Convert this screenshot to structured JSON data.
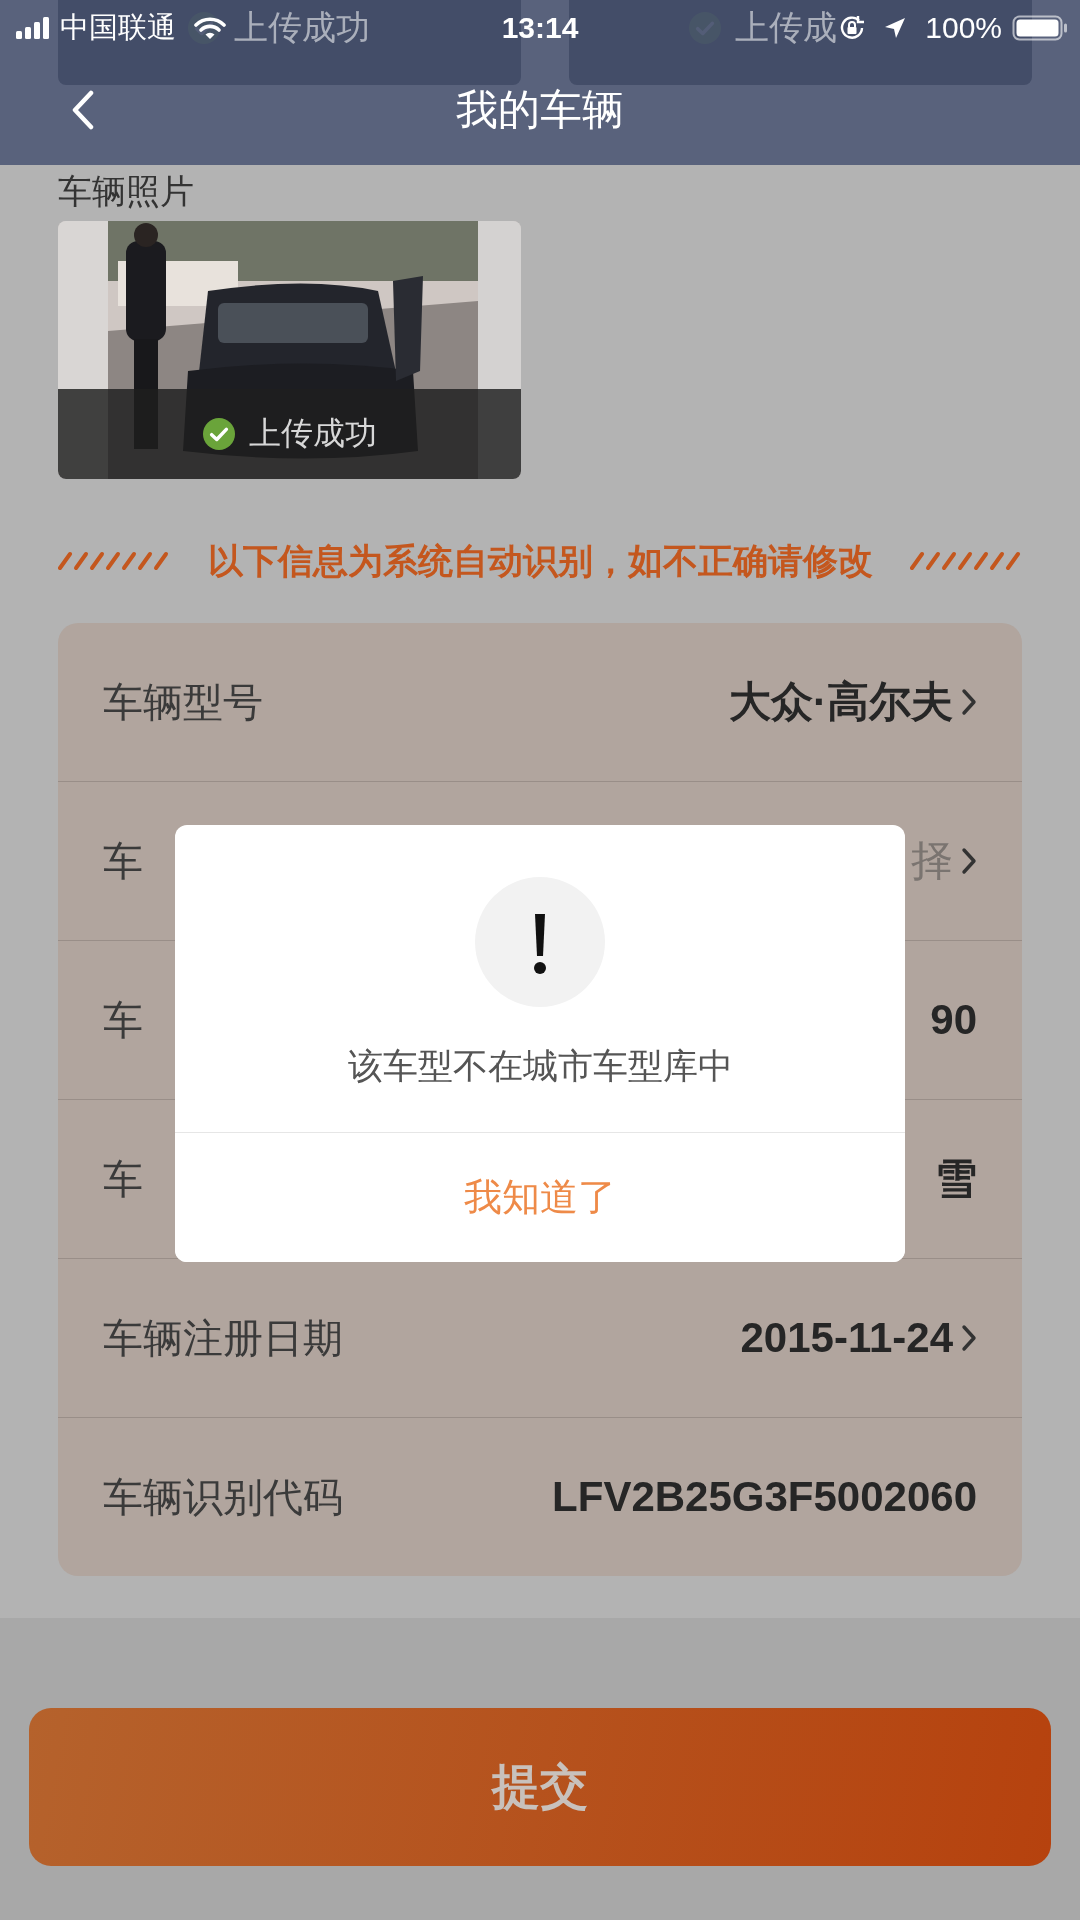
{
  "status_bar": {
    "carrier": "中国联通",
    "time": "13:14",
    "battery": "100%"
  },
  "nav": {
    "title": "我的车辆"
  },
  "upload_tiles_above": [
    {
      "status": "上传成功"
    },
    {
      "status": "上传成"
    }
  ],
  "photo_section": {
    "title": "车辆照片",
    "photos": [
      {
        "kind": "picture",
        "status": "上传成功"
      }
    ]
  },
  "notice": "以下信息为系统自动识别，如不正确请修改",
  "fields": [
    {
      "label": "车辆型号",
      "value": "大众·高尔夫",
      "muted": false,
      "chevron": true
    },
    {
      "label": "车",
      "value": "择",
      "muted": true,
      "chevron": true
    },
    {
      "label": "车",
      "value": "90",
      "muted": false,
      "chevron": false
    },
    {
      "label": "车",
      "value": "雪",
      "muted": false,
      "chevron": false
    },
    {
      "label": "车辆注册日期",
      "value": "2015-11-24",
      "muted": false,
      "chevron": true
    },
    {
      "label": "车辆识别代码",
      "value": "LFV2B25G3F5002060",
      "muted": false,
      "chevron": false
    }
  ],
  "dialog": {
    "message": "该车型不在城市车型库中",
    "button": "我知道了"
  },
  "submit": {
    "label": "提交"
  }
}
